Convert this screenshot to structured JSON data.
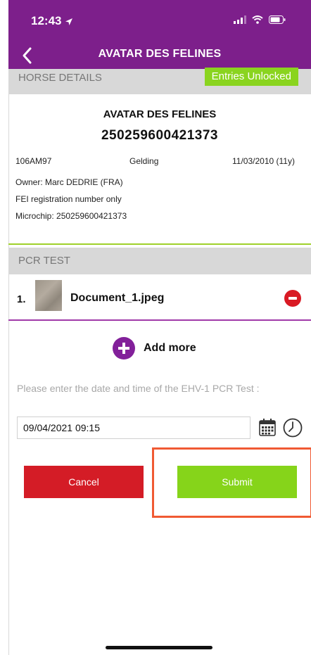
{
  "status_bar": {
    "time": "12:43"
  },
  "nav": {
    "title": "AVATAR DES FELINES"
  },
  "horse_details": {
    "section_label": "HORSE DETAILS",
    "badge": "Entries Unlocked",
    "name": "AVATAR DES FELINES",
    "ueln": "250259600421373",
    "fei_id": "106AM97",
    "sex": "Gelding",
    "birth_date": "11/03/2010 (11y)",
    "owner_line": "Owner:  Marc DEDRIE (FRA)",
    "registration_note": "FEI registration number only",
    "microchip_line": "Microchip:  250259600421373"
  },
  "pcr_test": {
    "section_label": "PCR TEST",
    "documents": [
      {
        "index": "1.",
        "filename": "Document_1.jpeg"
      }
    ],
    "add_more_label": "Add more",
    "prompt": "Please enter the date and time of the EHV-1 PCR Test :",
    "datetime_value": "09/04/2021 09:15"
  },
  "actions": {
    "cancel_label": "Cancel",
    "submit_label": "Submit"
  },
  "colors": {
    "brand_purple": "#7d1f8b",
    "success_green": "#86d41a",
    "danger_red": "#d41c26",
    "highlight_orange": "#f05a33"
  }
}
